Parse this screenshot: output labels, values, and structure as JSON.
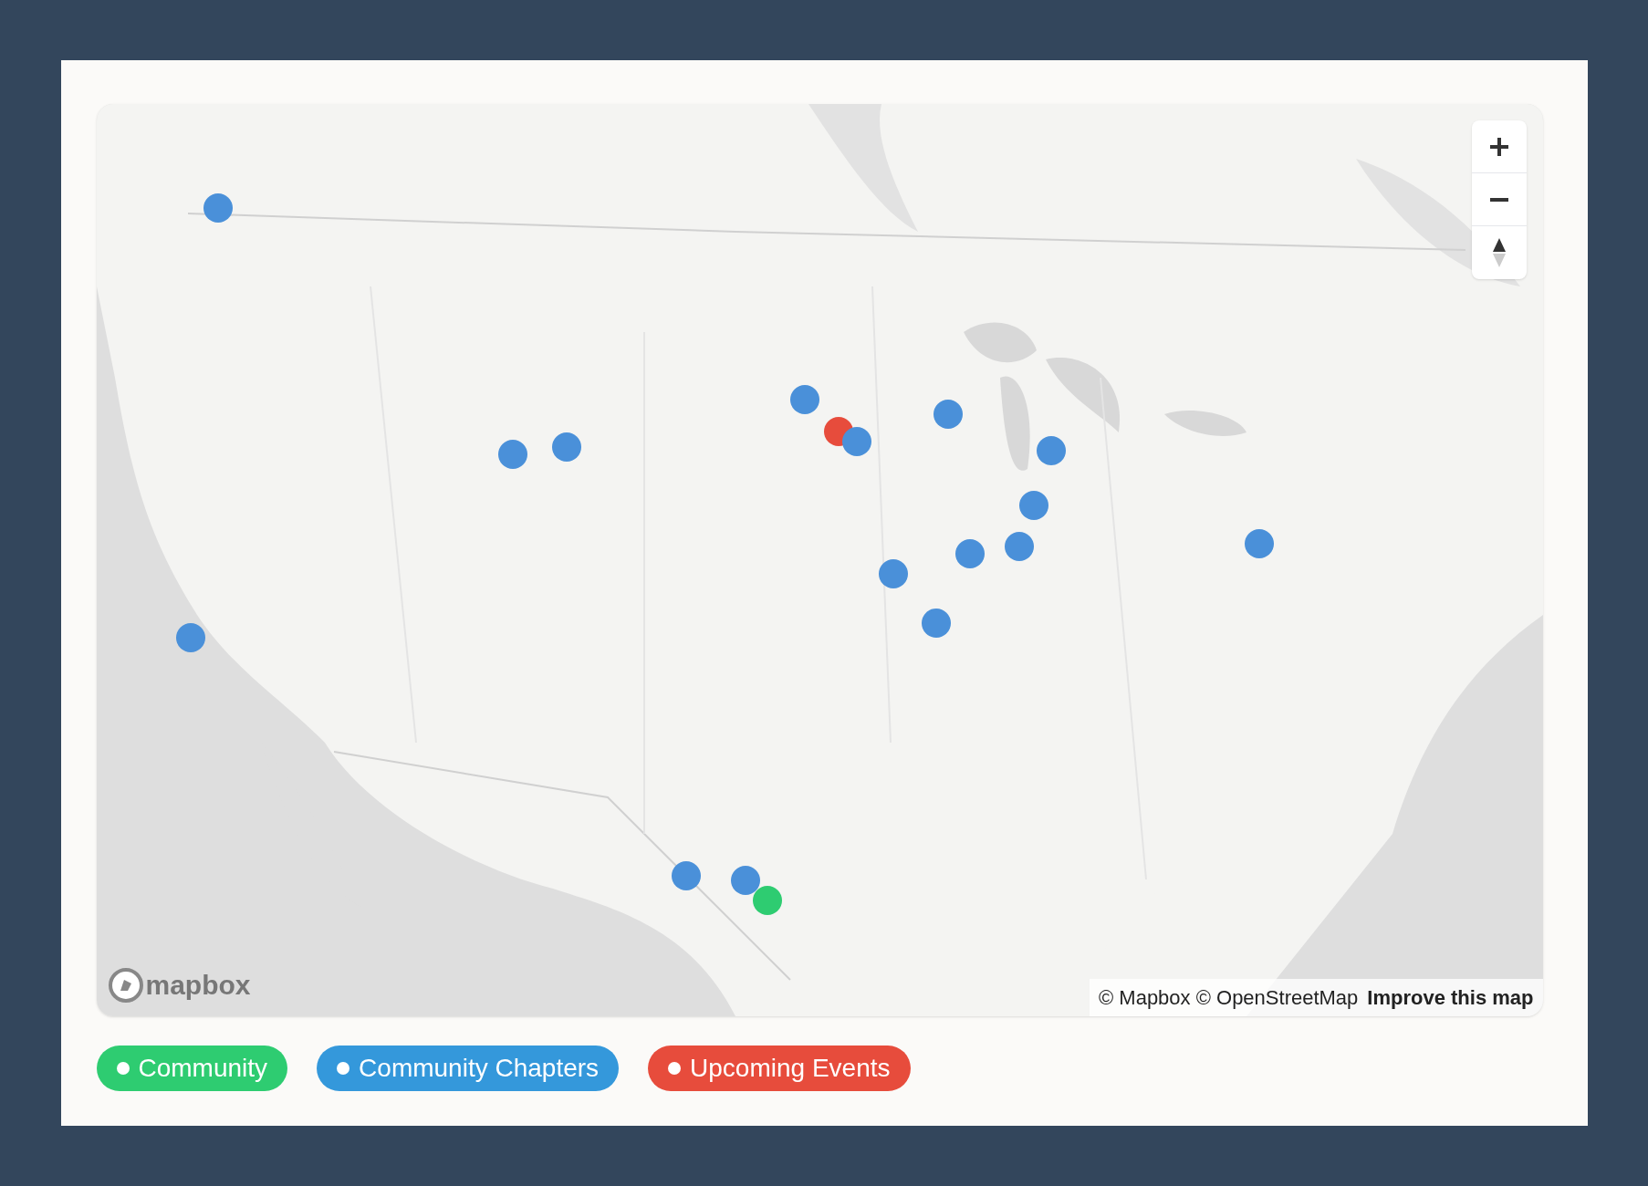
{
  "map": {
    "kind": "picture",
    "markers": [
      {
        "color": "#4a90d9"
      },
      {
        "color": "#4a90d9"
      },
      {
        "color": "#e74c3c"
      },
      {
        "color": "#4a90d9"
      },
      {
        "color": "#4a90d9"
      },
      {
        "color": "#4a90d9"
      },
      {
        "color": "#4a90d9"
      },
      {
        "color": "#4a90d9"
      },
      {
        "color": "#4a90d9"
      },
      {
        "color": "#4a90d9"
      },
      {
        "color": "#4a90d9"
      },
      {
        "color": "#4a90d9"
      },
      {
        "color": "#4a90d9"
      },
      {
        "color": "#4a90d9"
      },
      {
        "color": "#4a90d9"
      },
      {
        "color": "#4a90d9"
      },
      {
        "color": "#4a90d9"
      },
      {
        "color": "#2ecc71"
      }
    ],
    "logo": "mapbox",
    "attribution": "© Mapbox © OpenStreetMap",
    "improve_link": "Improve this map"
  },
  "legend": [
    {
      "label": "Community",
      "color": "#2ecc71"
    },
    {
      "label": "Community Chapters",
      "color": "#3498db"
    },
    {
      "label": "Upcoming Events",
      "color": "#e74c3c"
    }
  ]
}
